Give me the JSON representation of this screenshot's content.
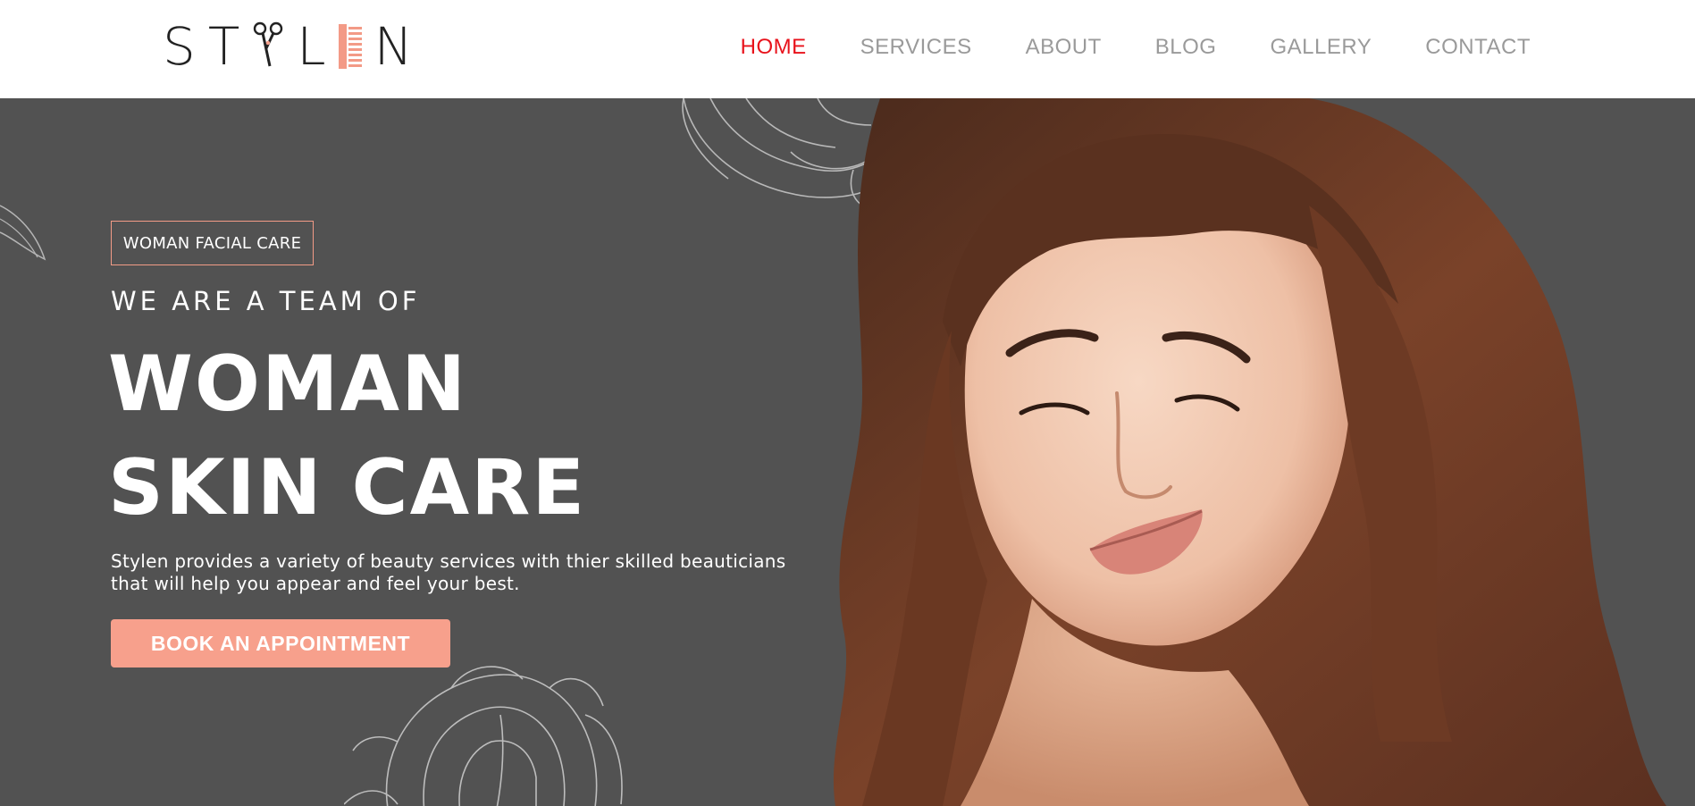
{
  "brand": {
    "logo_letters": [
      "S",
      "T",
      "L",
      "N"
    ],
    "logo_aria": "STYLEN",
    "colors": {
      "accent": "#f7a08c",
      "nav_active": "#e8121b",
      "nav": "#9a9a9a",
      "hero_bg": "#525252"
    }
  },
  "nav": {
    "items": [
      {
        "label": "HOME",
        "active": true
      },
      {
        "label": "SERVICES",
        "active": false
      },
      {
        "label": "ABOUT",
        "active": false
      },
      {
        "label": "BLOG",
        "active": false
      },
      {
        "label": "GALLERY",
        "active": false
      },
      {
        "label": "CONTACT",
        "active": false
      }
    ]
  },
  "hero": {
    "badge": "WOMAN FACIAL CARE",
    "kicker": "WE ARE A TEAM OF",
    "title_line1": "WOMAN",
    "title_line2": "SKIN CARE",
    "description_line1": "Stylen provides a variety of beauty services with thier skilled beauticians",
    "description_line2": "that will help you appear and feel your best.",
    "cta_label": "BOOK AN APPOINTMENT",
    "image_subject": "woman-portrait-illustration",
    "decorations": [
      "flower-line-art-icon",
      "leaf-line-art-icon"
    ]
  }
}
